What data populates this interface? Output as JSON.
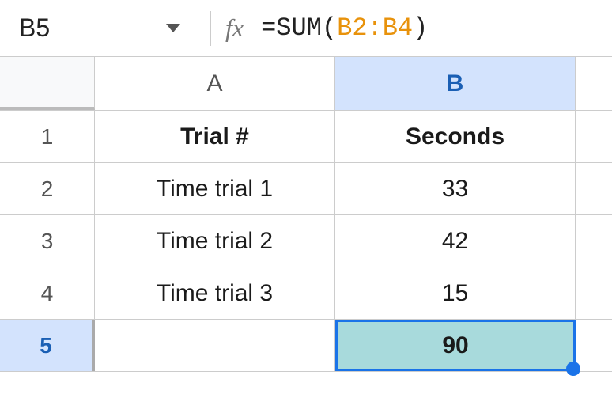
{
  "formula_bar": {
    "cell_ref": "B5",
    "fx_label": "fx",
    "formula_prefix": "=SUM(",
    "formula_range": "B2:B4",
    "formula_suffix": ")"
  },
  "columns": {
    "a": "A",
    "b": "B"
  },
  "rows": {
    "r1": "1",
    "r2": "2",
    "r3": "3",
    "r4": "4",
    "r5": "5"
  },
  "cells": {
    "a1": "Trial #",
    "b1": "Seconds",
    "a2": "Time trial 1",
    "b2": "33",
    "a3": "Time trial 2",
    "b3": "42",
    "a4": "Time trial 3",
    "b4": "15",
    "a5": "",
    "b5": "90"
  }
}
